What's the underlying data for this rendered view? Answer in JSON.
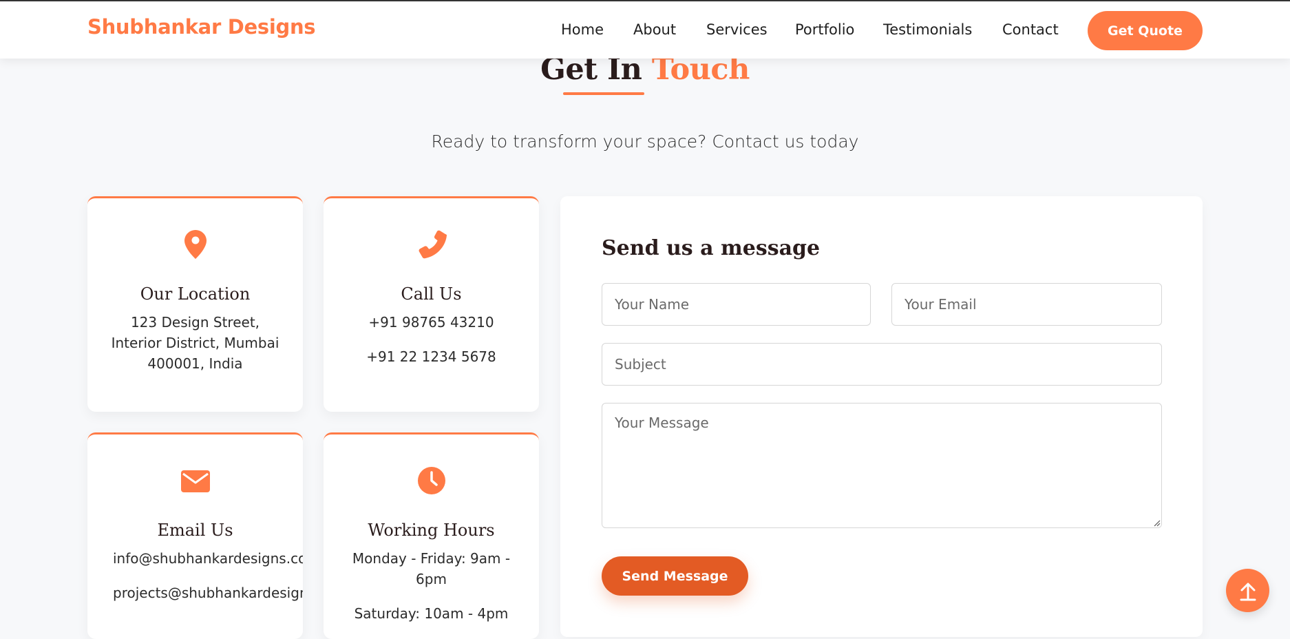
{
  "brand": "Shubhankar Designs",
  "nav": {
    "links": [
      "Home",
      "About",
      "Services",
      "Portfolio",
      "Testimonials",
      "Contact"
    ],
    "cta": "Get Quote"
  },
  "section": {
    "heading_main": "Get In ",
    "heading_accent": "Touch",
    "subtitle": "Ready to transform your space? Contact us today"
  },
  "cards": {
    "location": {
      "icon": "map-pin-icon",
      "title": "Our Location",
      "lines": [
        "123 Design Street,",
        "Interior District, Mumbai",
        "400001, India"
      ]
    },
    "call": {
      "icon": "phone-icon",
      "title": "Call Us",
      "lines": [
        "+91 98765 43210",
        "+91 22 1234 5678"
      ]
    },
    "email": {
      "icon": "envelope-icon",
      "title": "Email Us",
      "lines": [
        "info@shubhankardesigns.com",
        "projects@shubhankardesigns.c"
      ]
    },
    "hours": {
      "icon": "clock-icon",
      "title": "Working Hours",
      "lines": [
        "Monday - Friday: 9am -",
        "6pm",
        "Saturday: 10am - 4pm"
      ]
    }
  },
  "form": {
    "title": "Send us a message",
    "name_placeholder": "Your Name",
    "email_placeholder": "Your Email",
    "subject_placeholder": "Subject",
    "message_placeholder": "Your Message",
    "submit_label": "Send Message"
  },
  "colors": {
    "accent": "#ff7a45",
    "button_dark": "#e35b24",
    "heading": "#2a1c1c",
    "background": "#f7f8fa"
  }
}
